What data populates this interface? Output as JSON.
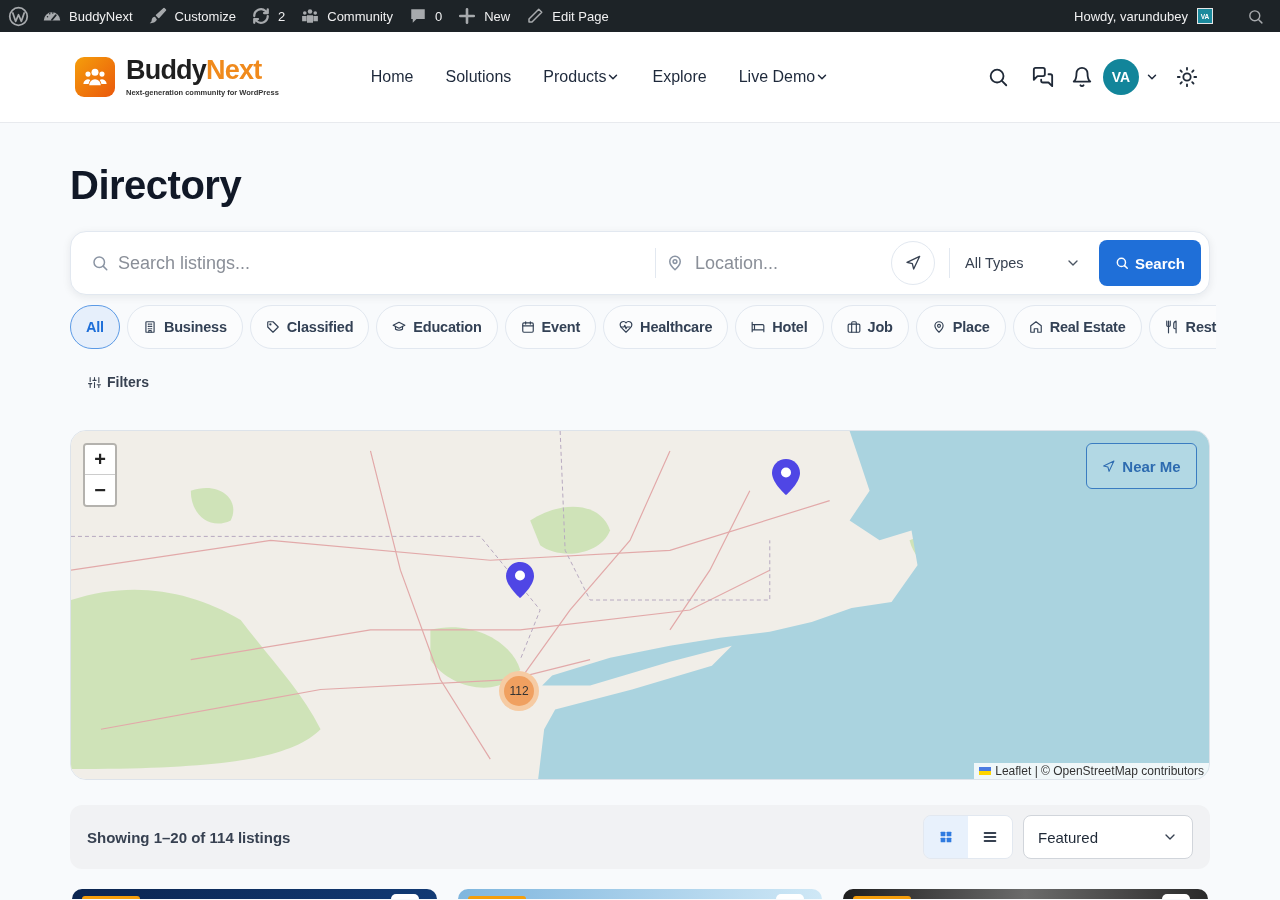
{
  "admin_bar": {
    "items": [
      {
        "label": "BuddyNext"
      },
      {
        "label": "Customize"
      },
      {
        "label": "2"
      },
      {
        "label": "Community"
      },
      {
        "label": "0"
      },
      {
        "label": "New"
      },
      {
        "label": "Edit Page"
      }
    ],
    "greeting": "Howdy, varundubey",
    "avatar_initials": "VA"
  },
  "header": {
    "logo": {
      "name": [
        "Buddy",
        "Next"
      ],
      "tagline": "Next-generation community for WordPress"
    },
    "nav": [
      {
        "label": "Home",
        "has_menu": false
      },
      {
        "label": "Solutions",
        "has_menu": false
      },
      {
        "label": "Products",
        "has_menu": true
      },
      {
        "label": "Explore",
        "has_menu": false
      },
      {
        "label": "Live Demo",
        "has_menu": true
      }
    ],
    "avatar_initials": "VA"
  },
  "page_title": "Directory",
  "search": {
    "keyword": {
      "placeholder": "Search listings..."
    },
    "location": {
      "placeholder": "Location..."
    },
    "type_select": {
      "value": "All Types"
    },
    "button": "Search"
  },
  "categories": [
    {
      "label": "All",
      "selected": true,
      "clipped": false
    },
    {
      "label": "Business",
      "selected": false,
      "clipped": false
    },
    {
      "label": "Classified",
      "selected": false,
      "clipped": false
    },
    {
      "label": "Education",
      "selected": false,
      "clipped": false
    },
    {
      "label": "Event",
      "selected": false,
      "clipped": false
    },
    {
      "label": "Healthcare",
      "selected": false,
      "clipped": false
    },
    {
      "label": "Hotel",
      "selected": false,
      "clipped": false
    },
    {
      "label": "Job",
      "selected": false,
      "clipped": false
    },
    {
      "label": "Place",
      "selected": false,
      "clipped": false
    },
    {
      "label": "Real Estate",
      "selected": false,
      "clipped": false
    },
    {
      "label": "Rest",
      "selected": false,
      "clipped": true
    }
  ],
  "filters_button": "Filters",
  "map": {
    "zoom_in": "+",
    "zoom_out": "−",
    "near_me": "Near Me",
    "markers": [
      {
        "kind": "pin"
      },
      {
        "kind": "pin"
      },
      {
        "kind": "cluster",
        "count": "112"
      }
    ],
    "attribution": "Leaflet | © OpenStreetMap contributors"
  },
  "results": {
    "summary": "Showing 1–20 of 114 listings",
    "views": [
      {
        "kind": "grid",
        "selected": true
      },
      {
        "kind": "list",
        "selected": false
      }
    ],
    "sort": {
      "value": "Featured"
    }
  },
  "listing_cards": [
    {
      "badge": true,
      "round_button": true
    },
    {
      "badge": true,
      "round_button": true
    },
    {
      "badge": true,
      "round_button": true
    }
  ]
}
